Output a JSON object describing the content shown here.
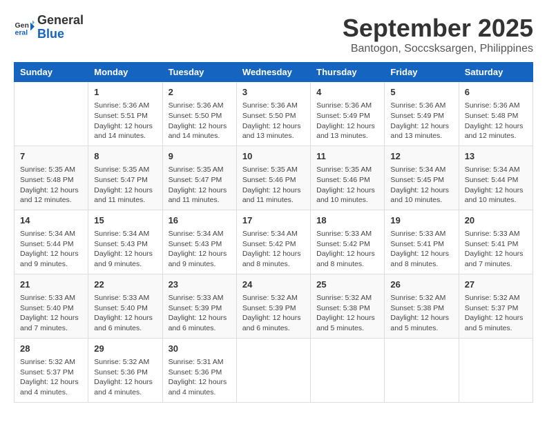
{
  "logo": {
    "line1": "General",
    "line2": "Blue"
  },
  "title": "September 2025",
  "location": "Bantogon, Soccsksargen, Philippines",
  "days_of_week": [
    "Sunday",
    "Monday",
    "Tuesday",
    "Wednesday",
    "Thursday",
    "Friday",
    "Saturday"
  ],
  "weeks": [
    [
      {
        "day": "",
        "detail": ""
      },
      {
        "day": "1",
        "detail": "Sunrise: 5:36 AM\nSunset: 5:51 PM\nDaylight: 12 hours\nand 14 minutes."
      },
      {
        "day": "2",
        "detail": "Sunrise: 5:36 AM\nSunset: 5:50 PM\nDaylight: 12 hours\nand 14 minutes."
      },
      {
        "day": "3",
        "detail": "Sunrise: 5:36 AM\nSunset: 5:50 PM\nDaylight: 12 hours\nand 13 minutes."
      },
      {
        "day": "4",
        "detail": "Sunrise: 5:36 AM\nSunset: 5:49 PM\nDaylight: 12 hours\nand 13 minutes."
      },
      {
        "day": "5",
        "detail": "Sunrise: 5:36 AM\nSunset: 5:49 PM\nDaylight: 12 hours\nand 13 minutes."
      },
      {
        "day": "6",
        "detail": "Sunrise: 5:36 AM\nSunset: 5:48 PM\nDaylight: 12 hours\nand 12 minutes."
      }
    ],
    [
      {
        "day": "7",
        "detail": "Sunrise: 5:35 AM\nSunset: 5:48 PM\nDaylight: 12 hours\nand 12 minutes."
      },
      {
        "day": "8",
        "detail": "Sunrise: 5:35 AM\nSunset: 5:47 PM\nDaylight: 12 hours\nand 11 minutes."
      },
      {
        "day": "9",
        "detail": "Sunrise: 5:35 AM\nSunset: 5:47 PM\nDaylight: 12 hours\nand 11 minutes."
      },
      {
        "day": "10",
        "detail": "Sunrise: 5:35 AM\nSunset: 5:46 PM\nDaylight: 12 hours\nand 11 minutes."
      },
      {
        "day": "11",
        "detail": "Sunrise: 5:35 AM\nSunset: 5:46 PM\nDaylight: 12 hours\nand 10 minutes."
      },
      {
        "day": "12",
        "detail": "Sunrise: 5:34 AM\nSunset: 5:45 PM\nDaylight: 12 hours\nand 10 minutes."
      },
      {
        "day": "13",
        "detail": "Sunrise: 5:34 AM\nSunset: 5:44 PM\nDaylight: 12 hours\nand 10 minutes."
      }
    ],
    [
      {
        "day": "14",
        "detail": "Sunrise: 5:34 AM\nSunset: 5:44 PM\nDaylight: 12 hours\nand 9 minutes."
      },
      {
        "day": "15",
        "detail": "Sunrise: 5:34 AM\nSunset: 5:43 PM\nDaylight: 12 hours\nand 9 minutes."
      },
      {
        "day": "16",
        "detail": "Sunrise: 5:34 AM\nSunset: 5:43 PM\nDaylight: 12 hours\nand 9 minutes."
      },
      {
        "day": "17",
        "detail": "Sunrise: 5:34 AM\nSunset: 5:42 PM\nDaylight: 12 hours\nand 8 minutes."
      },
      {
        "day": "18",
        "detail": "Sunrise: 5:33 AM\nSunset: 5:42 PM\nDaylight: 12 hours\nand 8 minutes."
      },
      {
        "day": "19",
        "detail": "Sunrise: 5:33 AM\nSunset: 5:41 PM\nDaylight: 12 hours\nand 8 minutes."
      },
      {
        "day": "20",
        "detail": "Sunrise: 5:33 AM\nSunset: 5:41 PM\nDaylight: 12 hours\nand 7 minutes."
      }
    ],
    [
      {
        "day": "21",
        "detail": "Sunrise: 5:33 AM\nSunset: 5:40 PM\nDaylight: 12 hours\nand 7 minutes."
      },
      {
        "day": "22",
        "detail": "Sunrise: 5:33 AM\nSunset: 5:40 PM\nDaylight: 12 hours\nand 6 minutes."
      },
      {
        "day": "23",
        "detail": "Sunrise: 5:33 AM\nSunset: 5:39 PM\nDaylight: 12 hours\nand 6 minutes."
      },
      {
        "day": "24",
        "detail": "Sunrise: 5:32 AM\nSunset: 5:39 PM\nDaylight: 12 hours\nand 6 minutes."
      },
      {
        "day": "25",
        "detail": "Sunrise: 5:32 AM\nSunset: 5:38 PM\nDaylight: 12 hours\nand 5 minutes."
      },
      {
        "day": "26",
        "detail": "Sunrise: 5:32 AM\nSunset: 5:38 PM\nDaylight: 12 hours\nand 5 minutes."
      },
      {
        "day": "27",
        "detail": "Sunrise: 5:32 AM\nSunset: 5:37 PM\nDaylight: 12 hours\nand 5 minutes."
      }
    ],
    [
      {
        "day": "28",
        "detail": "Sunrise: 5:32 AM\nSunset: 5:37 PM\nDaylight: 12 hours\nand 4 minutes."
      },
      {
        "day": "29",
        "detail": "Sunrise: 5:32 AM\nSunset: 5:36 PM\nDaylight: 12 hours\nand 4 minutes."
      },
      {
        "day": "30",
        "detail": "Sunrise: 5:31 AM\nSunset: 5:36 PM\nDaylight: 12 hours\nand 4 minutes."
      },
      {
        "day": "",
        "detail": ""
      },
      {
        "day": "",
        "detail": ""
      },
      {
        "day": "",
        "detail": ""
      },
      {
        "day": "",
        "detail": ""
      }
    ]
  ]
}
